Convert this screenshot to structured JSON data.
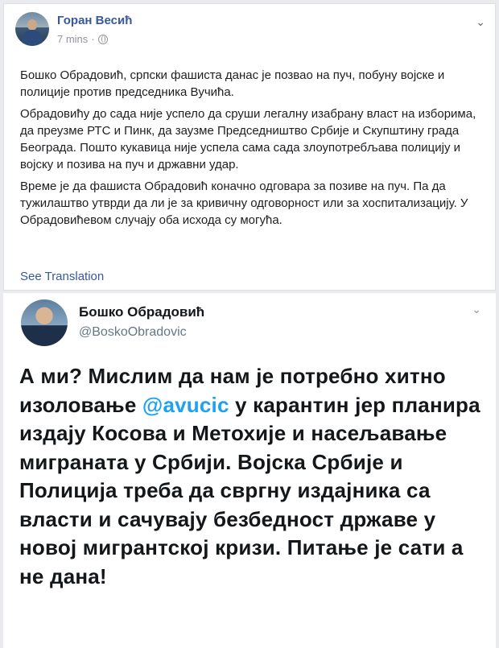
{
  "post": {
    "author": "Горан Весић",
    "time": "7 mins",
    "privacy_icon": "globe-icon",
    "options_icon": "chevron-down-icon",
    "paragraphs": [
      "Бошко Обрадовић, српски фашиста данас је позвао на пуч, побуну војске и полиције против председника Вучића.",
      "Обрадовићу до сада није успело да сруши легалну изабрану власт на изборима, да преузме РТС и Пинк, да заузме Председништво Србије и Скупштину града Београда. Пошто кукавица није успела сама сада злоупотребљава полицију и војску и позива на пуч и државни удар.",
      "Време је да фашиста Обрадовић коначно одговара за позиве на пуч. Па да тужилаштво утврди да ли је за кривичну одговорност или за хоспитализацију. У Обрадовићевом случају оба исхода су могућа."
    ],
    "see_translation": "See Translation"
  },
  "tweet": {
    "name": "Бошко Обрадовић",
    "handle": "@BoskoObradovic",
    "text_before": "А ми? Мислим да нам је потребно хитно изоловање ",
    "mention": "@avucic",
    "text_after": " у карантин јер планира издају Косова и Метохије и насељавање миграната у Србији. Војска Србије и Полиција треба да свргну издајника са власти и сачувају безбедност државе у новој мигрантској кризи. Питање је сати а не дана!"
  },
  "colors": {
    "fb_link": "#385898",
    "twitter_mention": "#1da1f2"
  }
}
